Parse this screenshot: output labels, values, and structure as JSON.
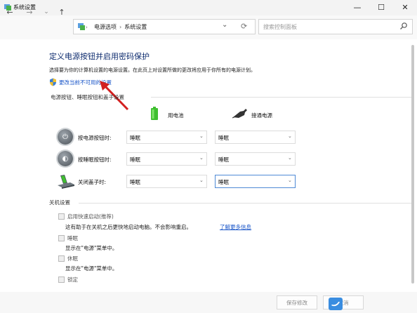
{
  "window": {
    "title": "系统设置",
    "buttons": {
      "minimize": "—",
      "maximize": "☐",
      "close": "✕"
    }
  },
  "nav": {
    "back": "←",
    "forward": "→",
    "recent": "⌄",
    "up": "↑",
    "refresh": "⟳",
    "dropdown": "⌄"
  },
  "address": {
    "parent": "电源选项",
    "separator": "›",
    "current": "系统设置"
  },
  "search": {
    "placeholder": "搜索控制面板"
  },
  "page": {
    "heading": "定义电源按钮并启用密码保护",
    "description": "选择要为你的计算机设置的电源设置。在此页上对设置所做的更改将应用于你所有的电源计划。",
    "change_link": "更改当前不可用的设置"
  },
  "power_group": {
    "title": "电源按钮、睡眠按钮和盖子设置",
    "col_battery": "用电池",
    "col_plugged": "接通电源",
    "rows": [
      {
        "label": "按电源按钮时:",
        "battery": "睡眠",
        "plugged": "睡眠"
      },
      {
        "label": "按睡眠按钮时:",
        "battery": "睡眠",
        "plugged": "睡眠"
      },
      {
        "label": "关闭盖子时:",
        "battery": "睡眠",
        "plugged": "睡眠"
      }
    ]
  },
  "shutdown_group": {
    "title": "关机设置",
    "options": [
      {
        "title": "启用快速启动(推荐)",
        "desc": "这有助于在关机之后更快地启动电脑。不会影响重启。",
        "link": "了解更多信息"
      },
      {
        "title": "睡眠",
        "desc": "显示在\"电源\"菜单中。"
      },
      {
        "title": "休眠",
        "desc": "显示在\"电源\"菜单中。"
      },
      {
        "title": "锁定",
        "desc": ""
      }
    ]
  },
  "footer": {
    "save": "保存修改",
    "cancel": "取消"
  },
  "colors": {
    "heading": "#0d2b6e",
    "link": "#1a56c8",
    "battery": "#3fbf2f",
    "arrow": "#d32020"
  }
}
